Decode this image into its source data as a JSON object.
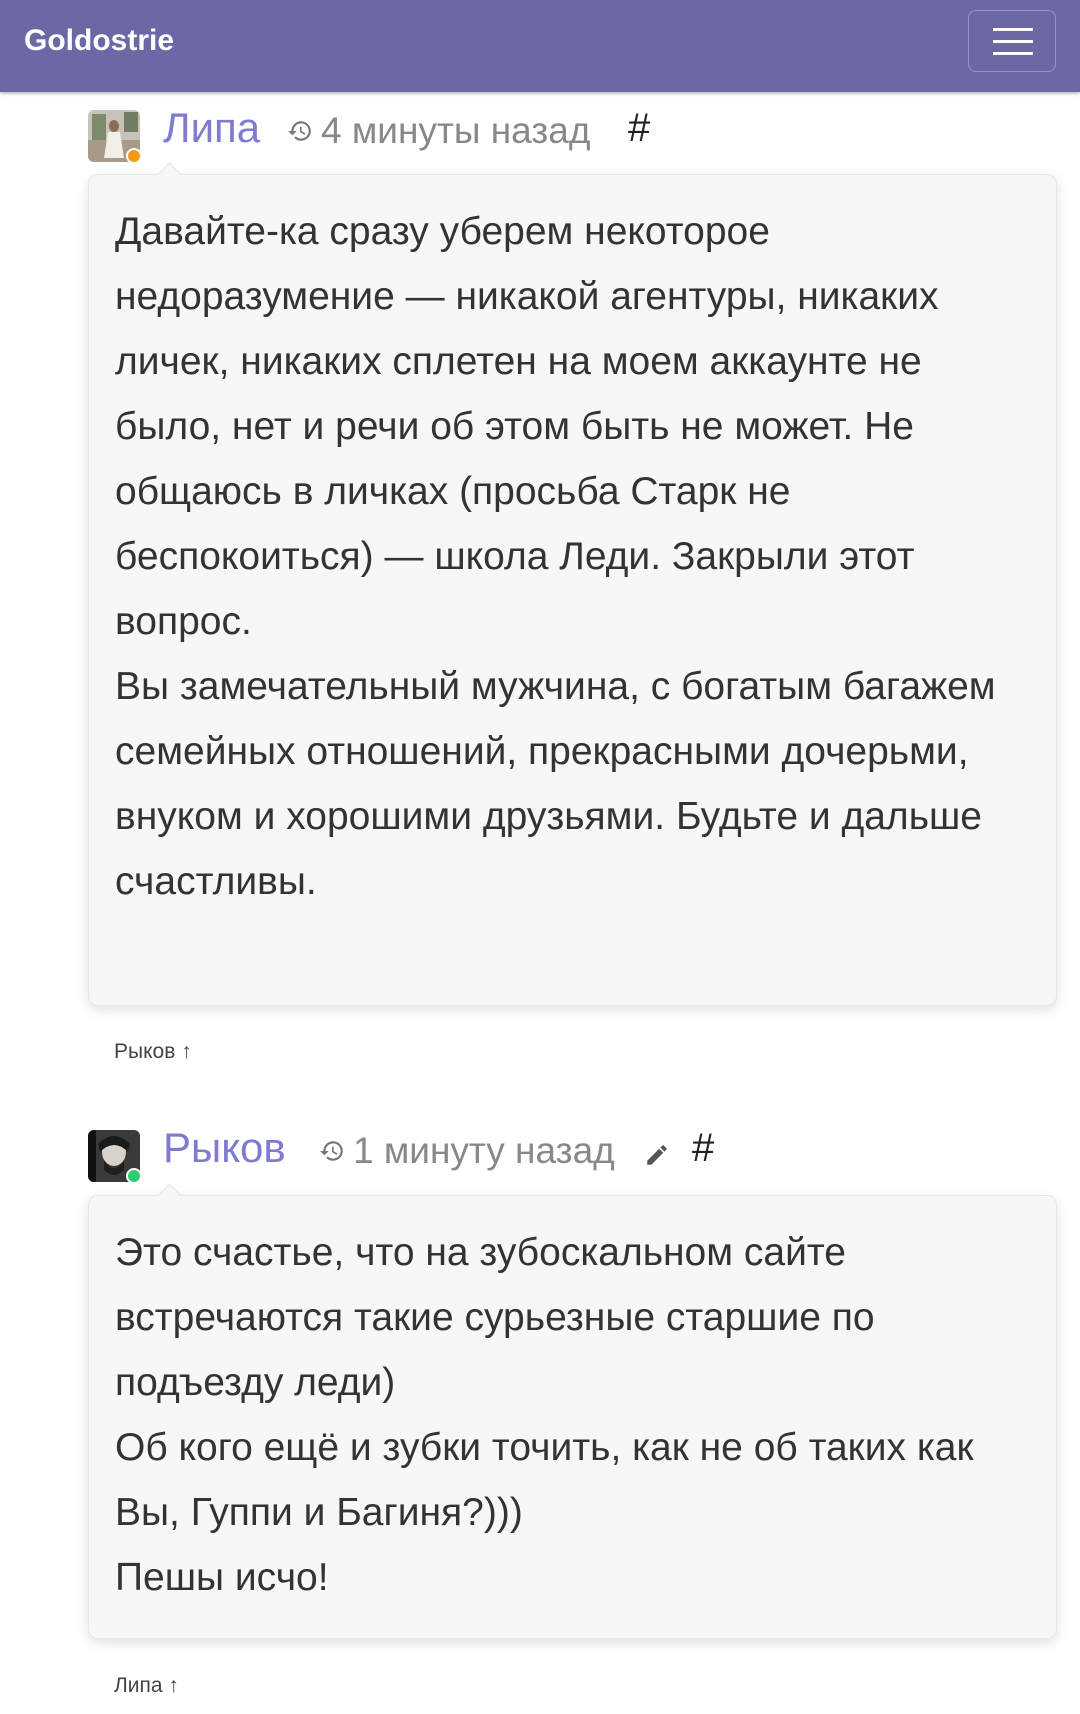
{
  "navbar": {
    "brand": "Goldostrie",
    "menu_icon": "hamburger-menu-icon",
    "bg_color": "#6b68a5"
  },
  "comments": [
    {
      "author": "Липа",
      "time": "4 минуты назад",
      "anchor": "#",
      "status_color": "#f39c12",
      "paragraphs": [
        "Давайте-ка сразу уберем некоторое недоразумение — никакой агентуры, никаких личек, никаких сплетен на моем аккаунте не было, нет и речи об этом быть не может. Не общаюсь в личках (просьба Старк не беспокоиться) — школа Леди. Закрыли этот вопрос.",
        "Вы замечательный мужчина, с богатым багажем семейных отношений, прекрасными дочерьми, внуком и хорошими друзьями. Будьте и дальше счастливы."
      ],
      "reply_to": "Рыков ↑"
    },
    {
      "author": "Рыков",
      "time": "1 минуту назад",
      "anchor": "#",
      "edited": true,
      "status_color": "#2ecc71",
      "paragraphs": [
        "Это счастье, что на зубоскальном сайте встречаются такие сурьезные старшие по подъезду леди)",
        "Об кого ещё и зубки точить, как не об таких как Вы, Гуппи и Багиня?)))",
        "Пешы исчо!"
      ],
      "reply_to": "Липа ↑"
    }
  ],
  "colors": {
    "author": "#7f7bcf",
    "bubble_bg": "#f7f7f9",
    "muted": "#888888"
  }
}
